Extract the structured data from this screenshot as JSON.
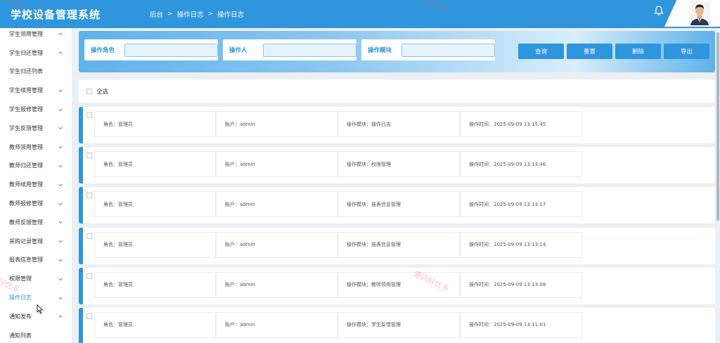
{
  "header": {
    "app_title": "学校设备管理系统",
    "breadcrumb": [
      "后台",
      "操作日志",
      "操作日志"
    ]
  },
  "sidebar": {
    "items": [
      {
        "label": "学生领用管理",
        "chevron": "down"
      },
      {
        "label": "学生归还管理",
        "chevron": "up"
      },
      {
        "label": "学生归还列表",
        "chevron": ""
      },
      {
        "label": "学生续用管理",
        "chevron": "down"
      },
      {
        "label": "学生报修管理",
        "chevron": "down"
      },
      {
        "label": "学生反馈管理",
        "chevron": "down"
      },
      {
        "label": "教师领用管理",
        "chevron": "down"
      },
      {
        "label": "教师归还管理",
        "chevron": "down"
      },
      {
        "label": "教师续用管理",
        "chevron": "down"
      },
      {
        "label": "教师报修管理",
        "chevron": "down"
      },
      {
        "label": "教师反馈管理",
        "chevron": "down"
      },
      {
        "label": "采购记录管理",
        "chevron": "down"
      },
      {
        "label": "报表信息管理",
        "chevron": "down"
      },
      {
        "label": "权限管理",
        "chevron": "down"
      },
      {
        "label": "操作日志",
        "chevron": "down"
      },
      {
        "label": "通知发布",
        "chevron": "up"
      },
      {
        "label": "通知列表",
        "chevron": ""
      }
    ]
  },
  "search": {
    "fields": [
      {
        "label": "操作角色",
        "value": ""
      },
      {
        "label": "操作人",
        "value": ""
      },
      {
        "label": "操作模块",
        "value": ""
      }
    ],
    "buttons": [
      "查询",
      "重置",
      "删除",
      "导出"
    ]
  },
  "select_all_label": "全选",
  "logs": [
    {
      "role": "角色：管理员",
      "account": "账户：admin",
      "module": "操作模块：操作日志",
      "time": "操作时间：2025-09-09 13:15:45"
    },
    {
      "role": "角色：管理员",
      "account": "账户：admin",
      "module": "操作模块：权限管理",
      "time": "操作时间：2025-09-09 13:13:46"
    },
    {
      "role": "角色：管理员",
      "account": "账户：admin",
      "module": "操作模块：报表信息管理",
      "time": "操作时间：2025-09-09 13:13:17"
    },
    {
      "role": "角色：管理员",
      "account": "账户：admin",
      "module": "操作模块：报表信息管理",
      "time": "操作时间：2025-09-09 13:13:14"
    },
    {
      "role": "角色：管理员",
      "account": "账户：admin",
      "module": "操作模块：教师领用管理",
      "time": "操作时间：2025-09-09 13:13:08"
    },
    {
      "role": "角色：管理员",
      "account": "账户：admin",
      "module": "操作模块：学生反馈管理",
      "time": "操作时间：2025-09-09 13:11:01"
    }
  ],
  "watermarks": [
    "源码好优多",
    "好优多",
    "源码好优多"
  ],
  "colors": {
    "primary": "#2f95dd",
    "page_bg": "#eceff3"
  },
  "icons": {
    "bell": "bell-icon",
    "avatar": "user-avatar"
  }
}
